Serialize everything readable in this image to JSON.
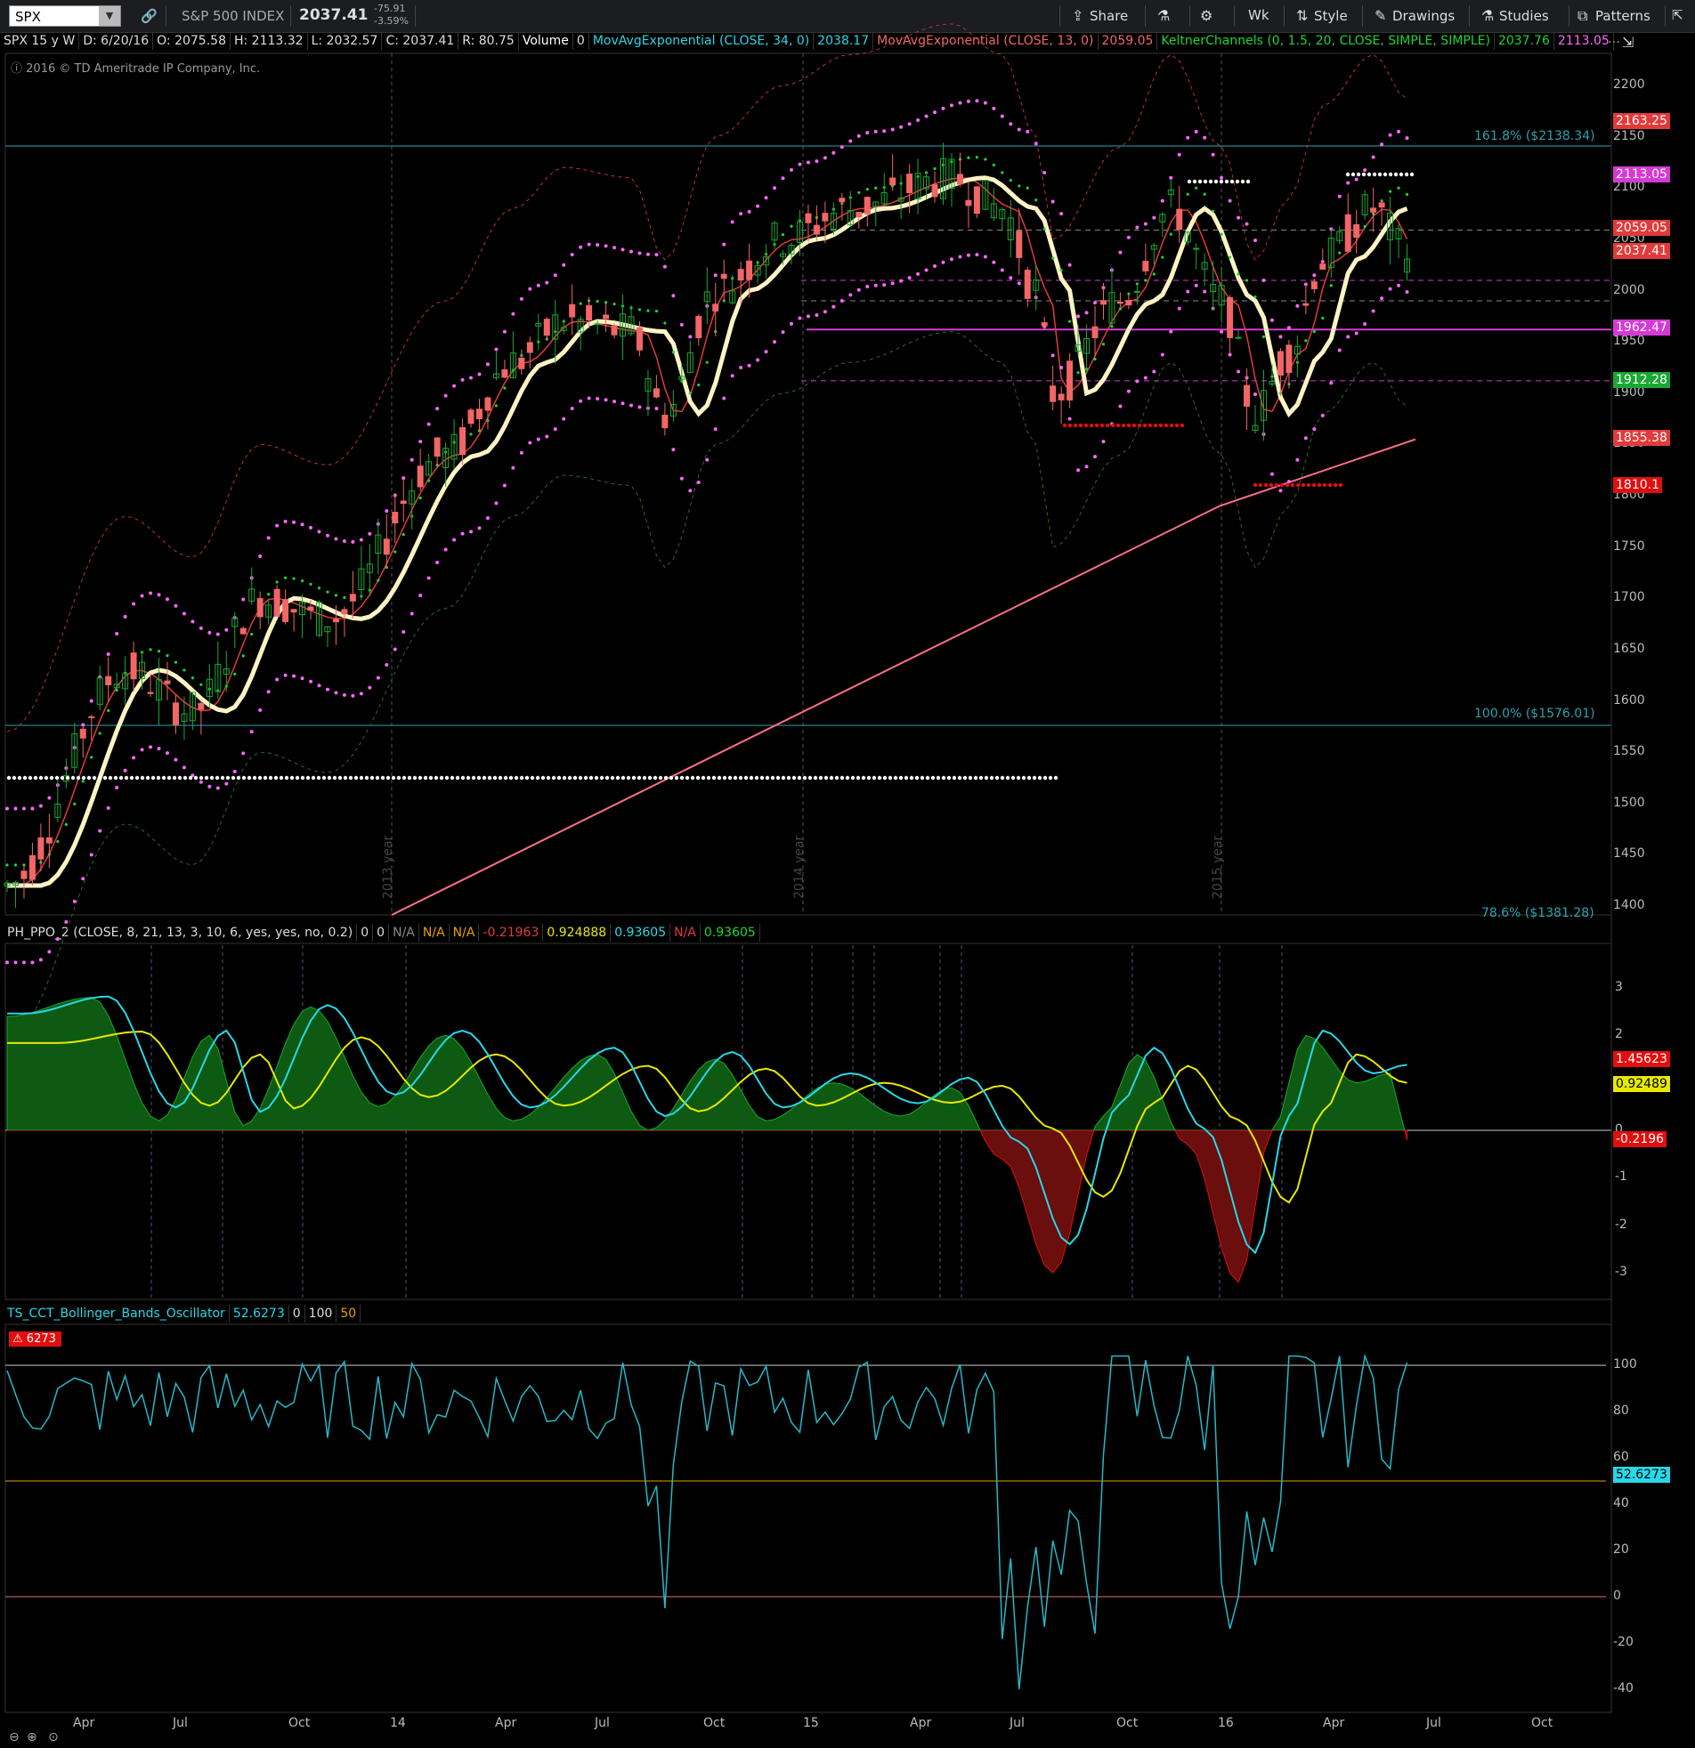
{
  "toolbar": {
    "symbol": "SPX",
    "instrument_name": "S&P 500 INDEX",
    "last_price": "2037.41",
    "net_change": "-75.91",
    "pct_change": "-3.59%",
    "buttons": {
      "share": "Share",
      "aggregation": "Wk",
      "style": "Style",
      "drawings": "Drawings",
      "studies": "Studies",
      "patterns": "Patterns"
    },
    "icons": [
      "link-icon",
      "beaker-icon",
      "gear-icon",
      "share-icon",
      "pencil-icon",
      "flask-icon",
      "patterns-icon"
    ]
  },
  "price_legend": {
    "chart_id": "SPX 15 y W",
    "date": "D: 6/20/16",
    "open": "O: 2075.58",
    "high": "H: 2113.32",
    "low": "L: 2032.57",
    "close": "C: 2037.41",
    "range": "R: 80.75",
    "volume_label": "Volume",
    "volume_value": "0",
    "ema34": "MovAvgExponential (CLOSE, 34, 0)",
    "ema34_value": "2038.17",
    "ema13": "MovAvgExponential (CLOSE, 13, 0)",
    "ema13_value": "2059.05",
    "keltner": "KeltnerChannels (0, 1.5, 20, CLOSE, SIMPLE, SIMPLE)",
    "keltner_mid": "2037.76",
    "keltner_upper": "2113.05",
    "copyright": "2016 © TD Ameritrade IP Company, Inc."
  },
  "ppo_legend": {
    "name": "PH_PPO_2 (CLOSE, 8, 21, 13, 3, 10, 6, yes, yes, no, 0.2)",
    "v1": "0",
    "v2": "0",
    "v3": "N/A",
    "v4": "N/A",
    "v5": "N/A",
    "v6": "-0.21963",
    "v7": "0.924888",
    "v8": "0.93605",
    "v9": "N/A",
    "v10": "0.93605"
  },
  "bb_legend": {
    "name": "TS_CCT_Bollinger_Bands_Oscillator",
    "value": "52.6273",
    "v1": "0",
    "v2": "100",
    "v3": "50",
    "alert": "6273"
  },
  "price_axis": {
    "ticks": [
      "2200",
      "2150",
      "2100",
      "2050",
      "2000",
      "1950",
      "1900",
      "1850",
      "1800",
      "1750",
      "1700",
      "1650",
      "1600",
      "1550",
      "1500",
      "1450",
      "1400"
    ],
    "tags": [
      {
        "label": "2163.25",
        "color": "#e23a3a"
      },
      {
        "label": "2113.05",
        "color": "#d63ad6"
      },
      {
        "label": "2059.05",
        "color": "#e23a3a"
      },
      {
        "label": "2037.41",
        "color": "#e23a3a"
      },
      {
        "label": "1962.47",
        "color": "#d63ad6"
      },
      {
        "label": "1912.28",
        "color": "#19a832"
      },
      {
        "label": "1855.38",
        "color": "#e23a3a"
      },
      {
        "label": "1810.1",
        "color": "#e20e0e"
      }
    ],
    "fib_labels": [
      "161.8% ($2138.34)",
      "100.0% ($1576.01)",
      "78.6% ($1381.28)"
    ],
    "year_labels": [
      "2013 year",
      "2014 year",
      "2015 year"
    ]
  },
  "ppo_axis": {
    "ticks": [
      "3",
      "2",
      "1",
      "0",
      "-1",
      "-2",
      "-3"
    ],
    "tags": [
      {
        "label": "1.45623",
        "color": "#e20e0e"
      },
      {
        "label": "0.92489",
        "color": "#e8e800"
      },
      {
        "label": "-0.2196",
        "color": "#e20e0e"
      }
    ]
  },
  "bb_axis": {
    "ticks": [
      "100",
      "80",
      "60",
      "40",
      "20",
      "0",
      "-20",
      "-40"
    ],
    "tag": "52.6273"
  },
  "time_axis": [
    "Apr",
    "Jul",
    "Oct",
    "14",
    "Apr",
    "Jul",
    "Oct",
    "15",
    "Apr",
    "Jul",
    "Oct",
    "16",
    "Apr",
    "Jul",
    "Oct"
  ],
  "colors": {
    "bull_candle": "#19a832",
    "bear_candle": "#f26666",
    "ema34": "#fff3c4",
    "ema13": "#e23a3a",
    "keltner_upper": "#ff66ff",
    "keltner_lower": "#ff66ff",
    "sma_long": "#ff6f8a",
    "fib_line": "#2aa3b0",
    "ppo_fast": "#27d8e8",
    "ppo_signal": "#e8e800",
    "bb_line": "#27b8c8",
    "ppo_hist_pos": "#0e5a12",
    "ppo_hist_neg": "#6a0e0e"
  }
}
